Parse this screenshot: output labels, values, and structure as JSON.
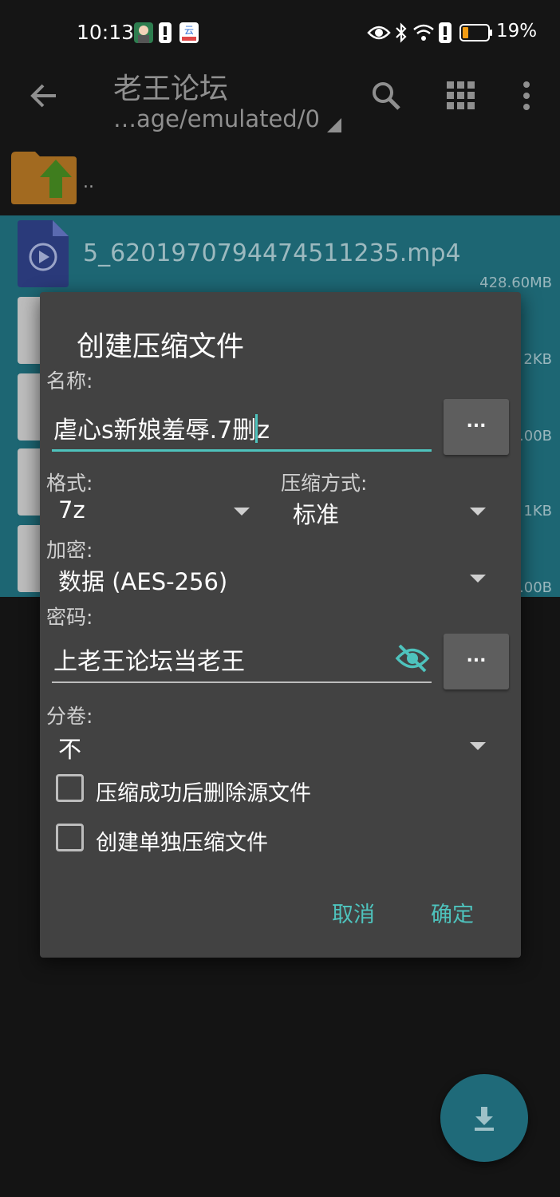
{
  "status_bar": {
    "time": "10:13",
    "battery": "19%",
    "icons": [
      "notification-avatar-icon",
      "alert-icon",
      "app-icon",
      "eye-icon",
      "bluetooth-icon",
      "wifi-icon",
      "alert-icon",
      "battery-icon"
    ]
  },
  "toolbar": {
    "title": "老王论坛",
    "path": "…age/emulated/0",
    "icons": [
      "back-arrow-icon",
      "search-icon",
      "grid-view-icon",
      "more-vert-icon"
    ]
  },
  "file_list": {
    "parent_label": "..",
    "selected_file": {
      "name": "5_6201970794474511235.mp4",
      "size": "428.60MB"
    },
    "partial_sizes": [
      "2KB",
      ".00B",
      "1KB",
      ".00B"
    ]
  },
  "dialog": {
    "title": "创建压缩文件",
    "name_label": "名称:",
    "name_value_before_cursor": "虐心s新娘羞辱.7删",
    "name_value_after_cursor": "z",
    "browse_label": "...",
    "format_label": "格式:",
    "format_value": "7z",
    "method_label": "压缩方式:",
    "method_value": "标准",
    "encryption_label": "加密:",
    "encryption_value": "数据 (AES-256)",
    "password_label": "密码:",
    "password_value": "上老王论坛当老王",
    "volume_label": "分卷:",
    "volume_value": "不",
    "checkbox_delete_source": "压缩成功后删除源文件",
    "checkbox_separate": "创建单独压缩文件",
    "cancel": "取消",
    "ok": "确定"
  },
  "colors": {
    "accent": "#4ec3bd",
    "selection": "#1d6673",
    "dialog_bg": "#424242",
    "app_bg": "#151515"
  }
}
